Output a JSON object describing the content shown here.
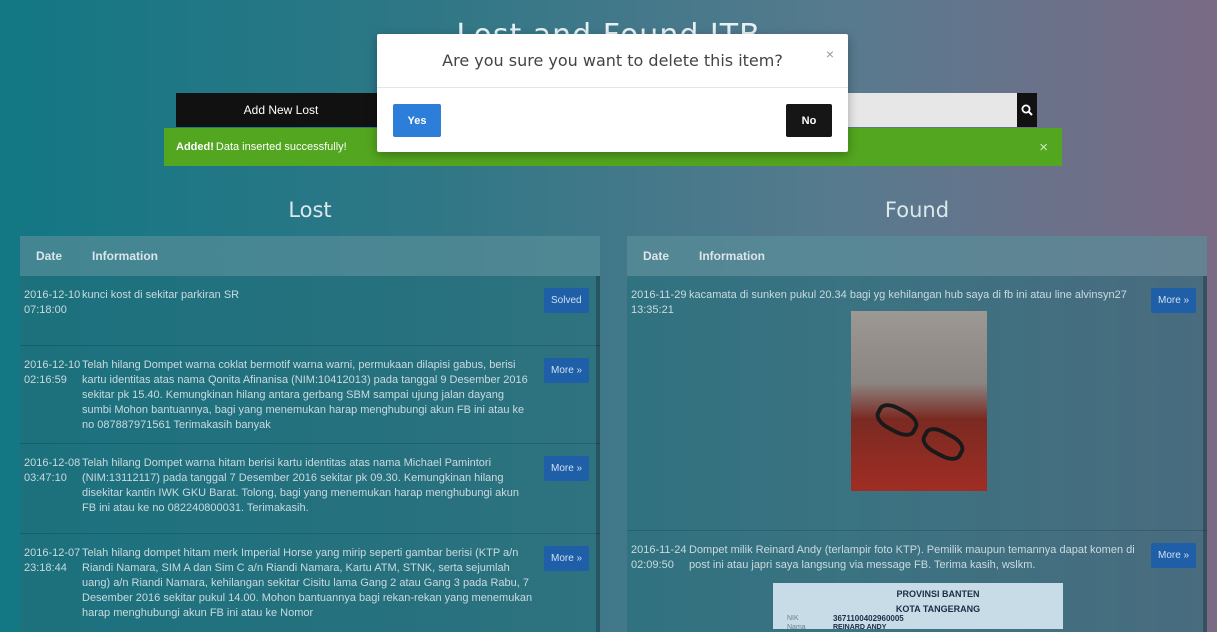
{
  "site": {
    "title": "Lost and Found ITB"
  },
  "toolbar": {
    "add_lost_label": "Add New Lost",
    "search_placeholder": ""
  },
  "alert": {
    "bold": "Added!",
    "text": "Data inserted successfully!",
    "close": "×"
  },
  "lost": {
    "title": "Lost",
    "headers": {
      "date": "Date",
      "info": "Information"
    },
    "rows": [
      {
        "date": "2016-12-10 07:18:00",
        "info": "kunci kost di sekitar parkiran SR",
        "action": "Solved"
      },
      {
        "date": "2016-12-10 02:16:59",
        "info": "Telah hilang Dompet warna coklat bermotif warna warni, permukaan dilapisi gabus, berisi kartu identitas atas nama Qonita Afinanisa (NIM:10412013) pada tanggal 9 Desember 2016 sekitar pk 15.40. Kemungkinan hilang antara gerbang SBM sampai ujung jalan dayang sumbi Mohon bantuannya, bagi yang menemukan harap menghubungi akun FB ini atau ke no 087887971561 Terimakasih banyak",
        "action": "More »"
      },
      {
        "date": "2016-12-08 03:47:10",
        "info": "Telah hilang Dompet warna hitam berisi kartu identitas atas nama Michael Pamintori (NIM:13112117) pada tanggal 7 Desember 2016 sekitar pk 09.30. Kemungkinan hilang disekitar kantin IWK GKU Barat. Tolong, bagi yang menemukan harap menghubungi akun FB ini atau ke no 082240800031. Terimakasih.",
        "action": "More »"
      },
      {
        "date": "2016-12-07 23:18:44",
        "info": "Telah hilang dompet hitam merk Imperial Horse yang mirip seperti gambar berisi (KTP a/n Riandi Namara, SIM A dan Sim C a/n Riandi Namara, Kartu ATM, STNK, serta sejumlah uang) a/n Riandi Namara, kehilangan sekitar Cisitu lama Gang 2 atau Gang 3 pada Rabu, 7 Desember 2016 sekitar pukul 14.00. Mohon bantuannya bagi rekan-rekan yang menemukan harap menghubungi akun FB ini atau ke Nomor",
        "action": "More »"
      }
    ]
  },
  "found": {
    "title": "Found",
    "headers": {
      "date": "Date",
      "info": "Information"
    },
    "rows": [
      {
        "date": "2016-11-29 13:35:21",
        "info": "kacamata di sunken pukul 20.34 bagi yg kehilangan hub saya di fb ini atau line alvinsyn27",
        "action": "More »"
      },
      {
        "date": "2016-11-24 02:09:50",
        "info": "Dompet milik Reinard Andy (terlampir foto KTP). Pemilik maupun temannya dapat komen di post ini atau japri saya langsung via message FB. Terima kasih, wslkm.",
        "action": "More »"
      }
    ],
    "ktp": {
      "line1": "PROVINSI BANTEN",
      "line2": "KOTA TANGERANG",
      "label1": "NIK",
      "nik": "3671100402960005",
      "label2": "Nama",
      "name": "REINARD ANDY"
    }
  },
  "modal": {
    "title": "Are you sure you want to delete this item?",
    "close": "×",
    "yes": "Yes",
    "no": "No"
  },
  "icons": {
    "search": "search-icon"
  }
}
